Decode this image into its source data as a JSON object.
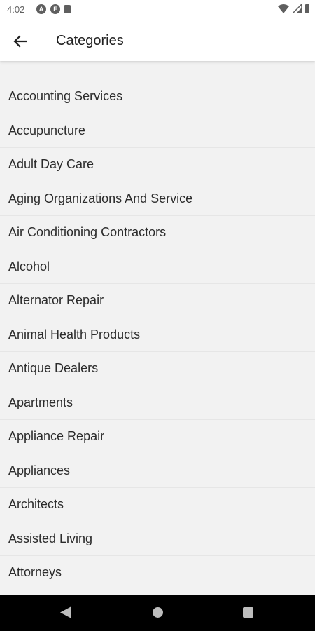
{
  "status_bar": {
    "time": "4:02",
    "left_icons": [
      "notification-a-icon",
      "notification-f-icon",
      "sd-card-icon"
    ],
    "right_icons": [
      "wifi-icon",
      "signal-icon",
      "battery-icon"
    ]
  },
  "app_bar": {
    "title": "Categories"
  },
  "categories": [
    "Accounting Services",
    "Accupuncture",
    "Adult Day Care",
    "Aging Organizations And Service",
    "Air Conditioning Contractors",
    "Alcohol",
    "Alternator Repair",
    "Animal Health Products",
    "Antique Dealers",
    "Apartments",
    "Appliance Repair",
    "Appliances",
    "Architects",
    "Assisted Living",
    "Attorneys"
  ],
  "colors": {
    "background": "#f2f2f2",
    "app_bar": "#ffffff",
    "text": "#2b2b2b",
    "nav_bar": "#000000"
  }
}
